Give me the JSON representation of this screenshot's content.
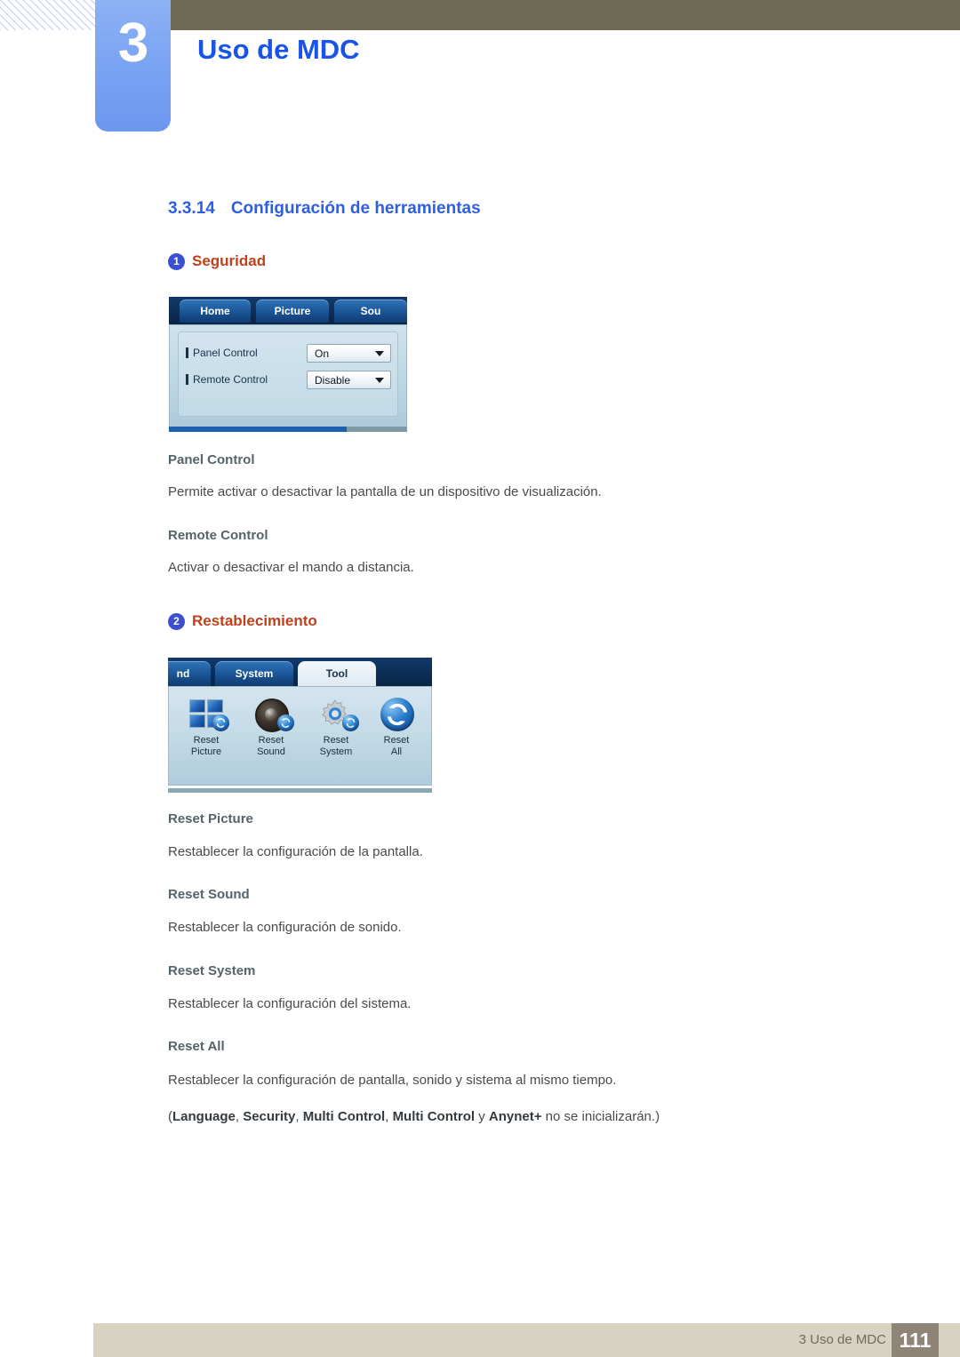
{
  "header": {
    "chapter_number": "3",
    "chapter_title": "Uso de MDC"
  },
  "section": {
    "number": "3.3.14",
    "title": "Configuración de herramientas"
  },
  "blocks": [
    {
      "badge": "1",
      "label": "Seguridad"
    },
    {
      "badge": "2",
      "label": "Restablecimiento"
    }
  ],
  "security_screenshot": {
    "tabs": [
      "Home",
      "Picture",
      "Sou"
    ],
    "rows": [
      {
        "label": "Panel Control",
        "value": "On"
      },
      {
        "label": "Remote Control",
        "value": "Disable"
      }
    ]
  },
  "tool_screenshot": {
    "tabs": [
      {
        "label": "nd",
        "active": false
      },
      {
        "label": "System",
        "active": false
      },
      {
        "label": "Tool",
        "active": true
      }
    ],
    "items": [
      {
        "icon": "grid-icon",
        "line1": "Reset",
        "line2": "Picture"
      },
      {
        "icon": "speaker-icon",
        "line1": "Reset",
        "line2": "Sound"
      },
      {
        "icon": "gear-icon",
        "line1": "Reset",
        "line2": "System"
      },
      {
        "icon": "refresh-icon",
        "line1": "Reset",
        "line2": "All"
      }
    ]
  },
  "definitions": [
    {
      "term": "Panel Control",
      "description": "Permite activar o desactivar la pantalla de un dispositivo de visualización."
    },
    {
      "term": "Remote Control",
      "description": "Activar o desactivar el mando a distancia."
    },
    {
      "term": "Reset Picture",
      "description": "Restablecer la configuración de la pantalla."
    },
    {
      "term": "Reset Sound",
      "description": "Restablecer la configuración de sonido."
    },
    {
      "term": "Reset System",
      "description": "Restablecer la configuración del sistema."
    },
    {
      "term": "Reset All",
      "description": "Restablecer la configuración de pantalla, sonido y sistema al mismo tiempo."
    }
  ],
  "note": {
    "open_paren": "(",
    "term1": "Language",
    "sep1": ", ",
    "term2": "Security",
    "sep2": ", ",
    "term3": "Multi Control",
    "sep3": ", ",
    "term4": "Multi Control",
    "sep4": " y ",
    "term5": "Anynet+",
    "tail": " no se inicializarán.)"
  },
  "footer": {
    "text": "3 Uso de MDC",
    "page": "111"
  },
  "colors": {
    "heading_blue": "#2f5fe0",
    "label_orange": "#c0401b",
    "badge_blue": "#3b4fd1",
    "olive": "#6e6a54",
    "tab_blue": "#7ba5f3",
    "footer_bg": "#d8d3c1",
    "page_box": "#8f8577"
  }
}
